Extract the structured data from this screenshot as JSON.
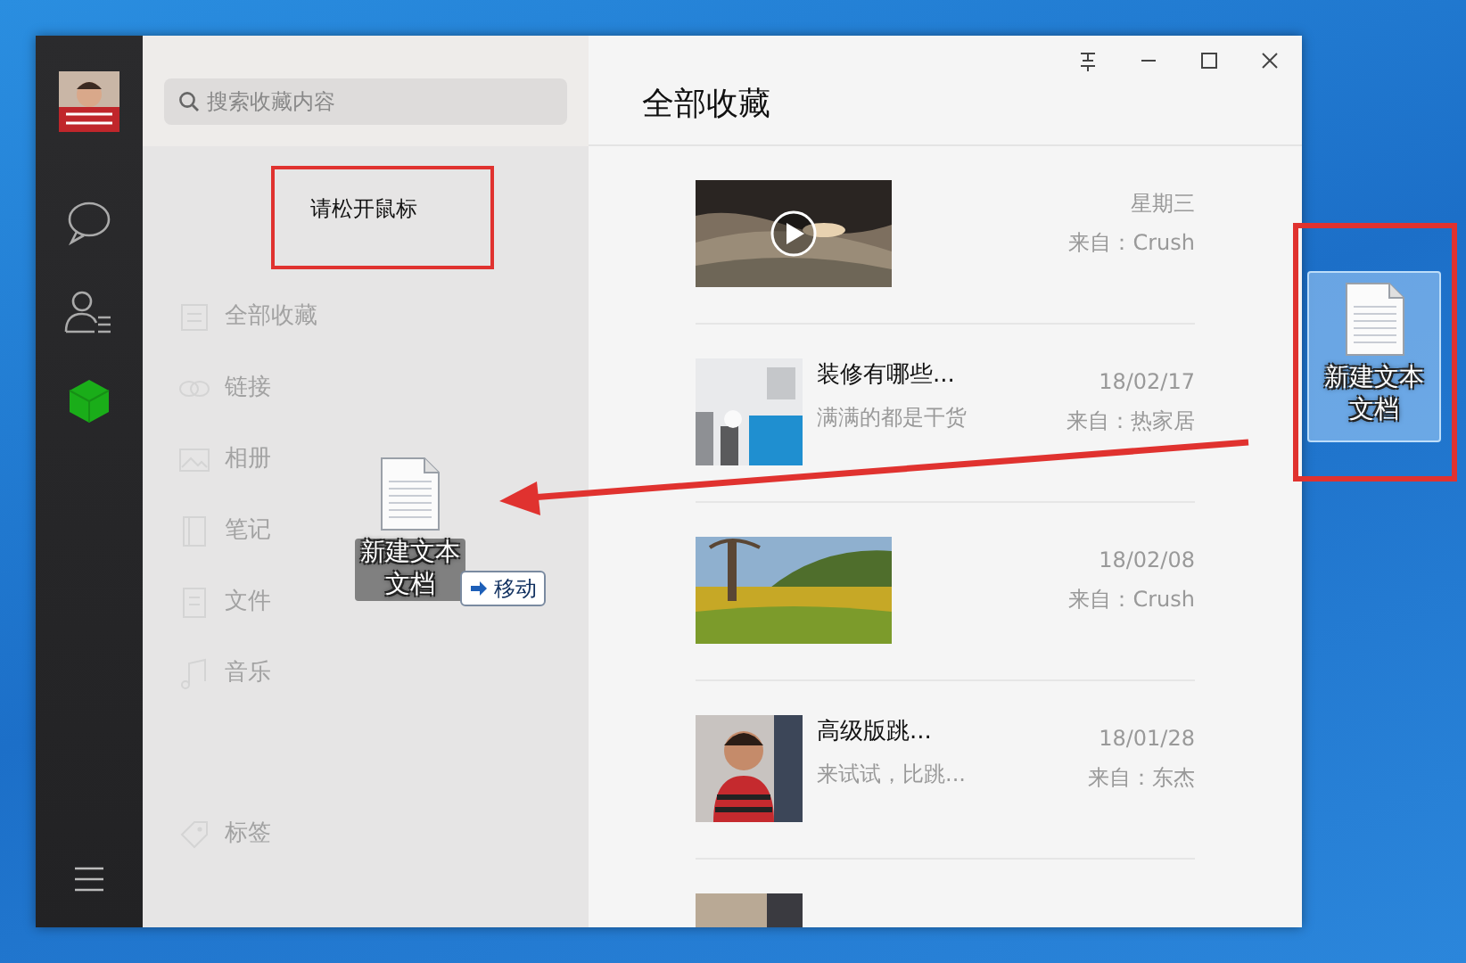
{
  "sidebar": {
    "items": [
      {
        "kind": "avatar"
      },
      {
        "kind": "chat",
        "selected": false
      },
      {
        "kind": "contacts",
        "selected": false
      },
      {
        "kind": "favorites",
        "selected": true
      },
      {
        "kind": "menu"
      }
    ]
  },
  "search": {
    "placeholder": "搜索收藏内容"
  },
  "drop_hint": "请松开鼠标",
  "categories": [
    {
      "kind": "all",
      "label": "全部收藏"
    },
    {
      "kind": "link",
      "label": "链接"
    },
    {
      "kind": "album",
      "label": "相册"
    },
    {
      "kind": "note",
      "label": "笔记"
    },
    {
      "kind": "file",
      "label": "文件"
    },
    {
      "kind": "music",
      "label": "音乐"
    },
    {
      "kind": "tag",
      "label": "标签"
    }
  ],
  "dragged_file": {
    "label": "新建文本文档",
    "action": "移动"
  },
  "header": "全部收藏",
  "favorites": [
    {
      "kind": "video",
      "date": "星期三",
      "source": "来自：Crush"
    },
    {
      "kind": "article",
      "title": "装修有哪些...",
      "summary": "满满的都是干货",
      "date": "18/02/17",
      "source": "来自：热家居"
    },
    {
      "date": "18/02/08",
      "source": "来自：Crush"
    },
    {
      "kind": "article",
      "title": "高级版跳...",
      "summary": "来试试，比跳...",
      "date": "18/01/28",
      "source": "来自：东杰"
    },
    {
      "kind": "partial"
    }
  ],
  "desktop_icon": {
    "label": "新建文本文档",
    "selected": true
  }
}
